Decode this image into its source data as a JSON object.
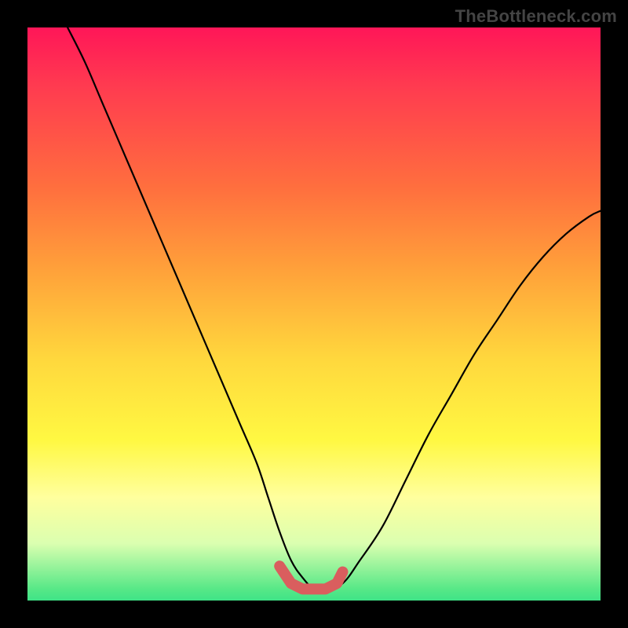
{
  "attribution": "TheBottleneck.com",
  "colors": {
    "background": "#000000",
    "curve": "#000000",
    "marker_fill": "#d95e5e",
    "marker_stroke": "#d95e5e",
    "gradient_stops": [
      "#ff1658",
      "#ff3a50",
      "#ff6f3e",
      "#ffa03a",
      "#ffd83d",
      "#fff842",
      "#ffff9e",
      "#dbffb0",
      "#57e887",
      "#3fe387"
    ]
  },
  "chart_data": {
    "type": "line",
    "title": "",
    "xlabel": "",
    "ylabel": "",
    "xlim": [
      0,
      100
    ],
    "ylim": [
      0,
      100
    ],
    "grid": false,
    "legend": false,
    "series": [
      {
        "name": "bottleneck-curve",
        "color": "#000000",
        "x": [
          7,
          10,
          13,
          16,
          19,
          22,
          25,
          28,
          31,
          34,
          37,
          40,
          42,
          44,
          46,
          48,
          50,
          52,
          55,
          58,
          62,
          66,
          70,
          74,
          78,
          82,
          86,
          90,
          94,
          98,
          100
        ],
        "y": [
          100,
          94,
          87,
          80,
          73,
          66,
          59,
          52,
          45,
          38,
          31,
          24,
          18,
          12,
          7,
          4,
          2,
          2,
          3,
          7,
          13,
          21,
          29,
          36,
          43,
          49,
          55,
          60,
          64,
          67,
          68
        ]
      },
      {
        "name": "optimal-marker",
        "color": "#d95e5e",
        "x": [
          44,
          46,
          48,
          50,
          52,
          54,
          55
        ],
        "y": [
          6,
          3,
          2,
          2,
          2,
          3,
          5
        ]
      }
    ],
    "annotations": []
  }
}
